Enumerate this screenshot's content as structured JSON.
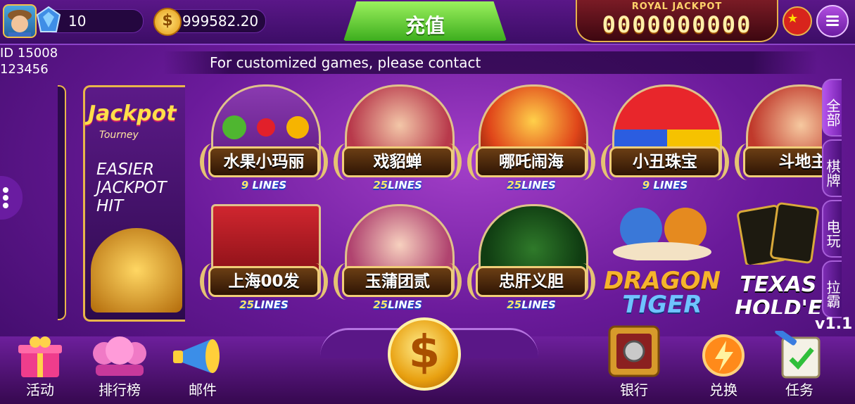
{
  "header": {
    "gem_count": "10",
    "coin_symbol": "$",
    "coin_balance": "999582.20",
    "recharge_label": "充值",
    "jackpot_title": "ROYAL JACKPOT",
    "jackpot_value": "0000000000"
  },
  "player": {
    "id_line": "ID 15008",
    "second_line": "123456"
  },
  "notice": "For customized games, please contact",
  "banner": {
    "title": "Jackpot",
    "subtitle": "Tourney",
    "text": "EASIER JACKPOT HIT"
  },
  "games": [
    {
      "name": "水果小玛丽",
      "lines_num": "9",
      "lines_word": " LINES"
    },
    {
      "name": "戏貂蝉",
      "lines_num": "25",
      "lines_word": "LINES"
    },
    {
      "name": "哪吒闹海",
      "lines_num": "25",
      "lines_word": "LINES"
    },
    {
      "name": "小丑珠宝",
      "lines_num": "9",
      "lines_word": " LINES"
    },
    {
      "name": "斗地主",
      "lines_num": "",
      "lines_word": ""
    },
    {
      "name": "上海00发",
      "lines_num": "25",
      "lines_word": "LINES"
    },
    {
      "name": "玉蒲团贰",
      "lines_num": "25",
      "lines_word": "LINES"
    },
    {
      "name": "忠肝义胆",
      "lines_num": "25",
      "lines_word": "LINES"
    }
  ],
  "logo_games": [
    {
      "line1": "DRAGON",
      "line2": "TIGER"
    },
    {
      "line1": "TEXAS",
      "line2": "HOLD'EM"
    }
  ],
  "side_tabs": [
    "全部",
    "棋牌",
    "电玩",
    "拉霸"
  ],
  "version": "v1.1",
  "bottom": {
    "activity": "活动",
    "ranking": "排行榜",
    "mail": "邮件",
    "shop_symbol": "$",
    "bank": "银行",
    "exchange": "兑换",
    "tasks": "任务"
  },
  "colors": {
    "accent_green": "#3dae1e",
    "gold": "#e9b64a",
    "purple": "#6a1a9a"
  }
}
